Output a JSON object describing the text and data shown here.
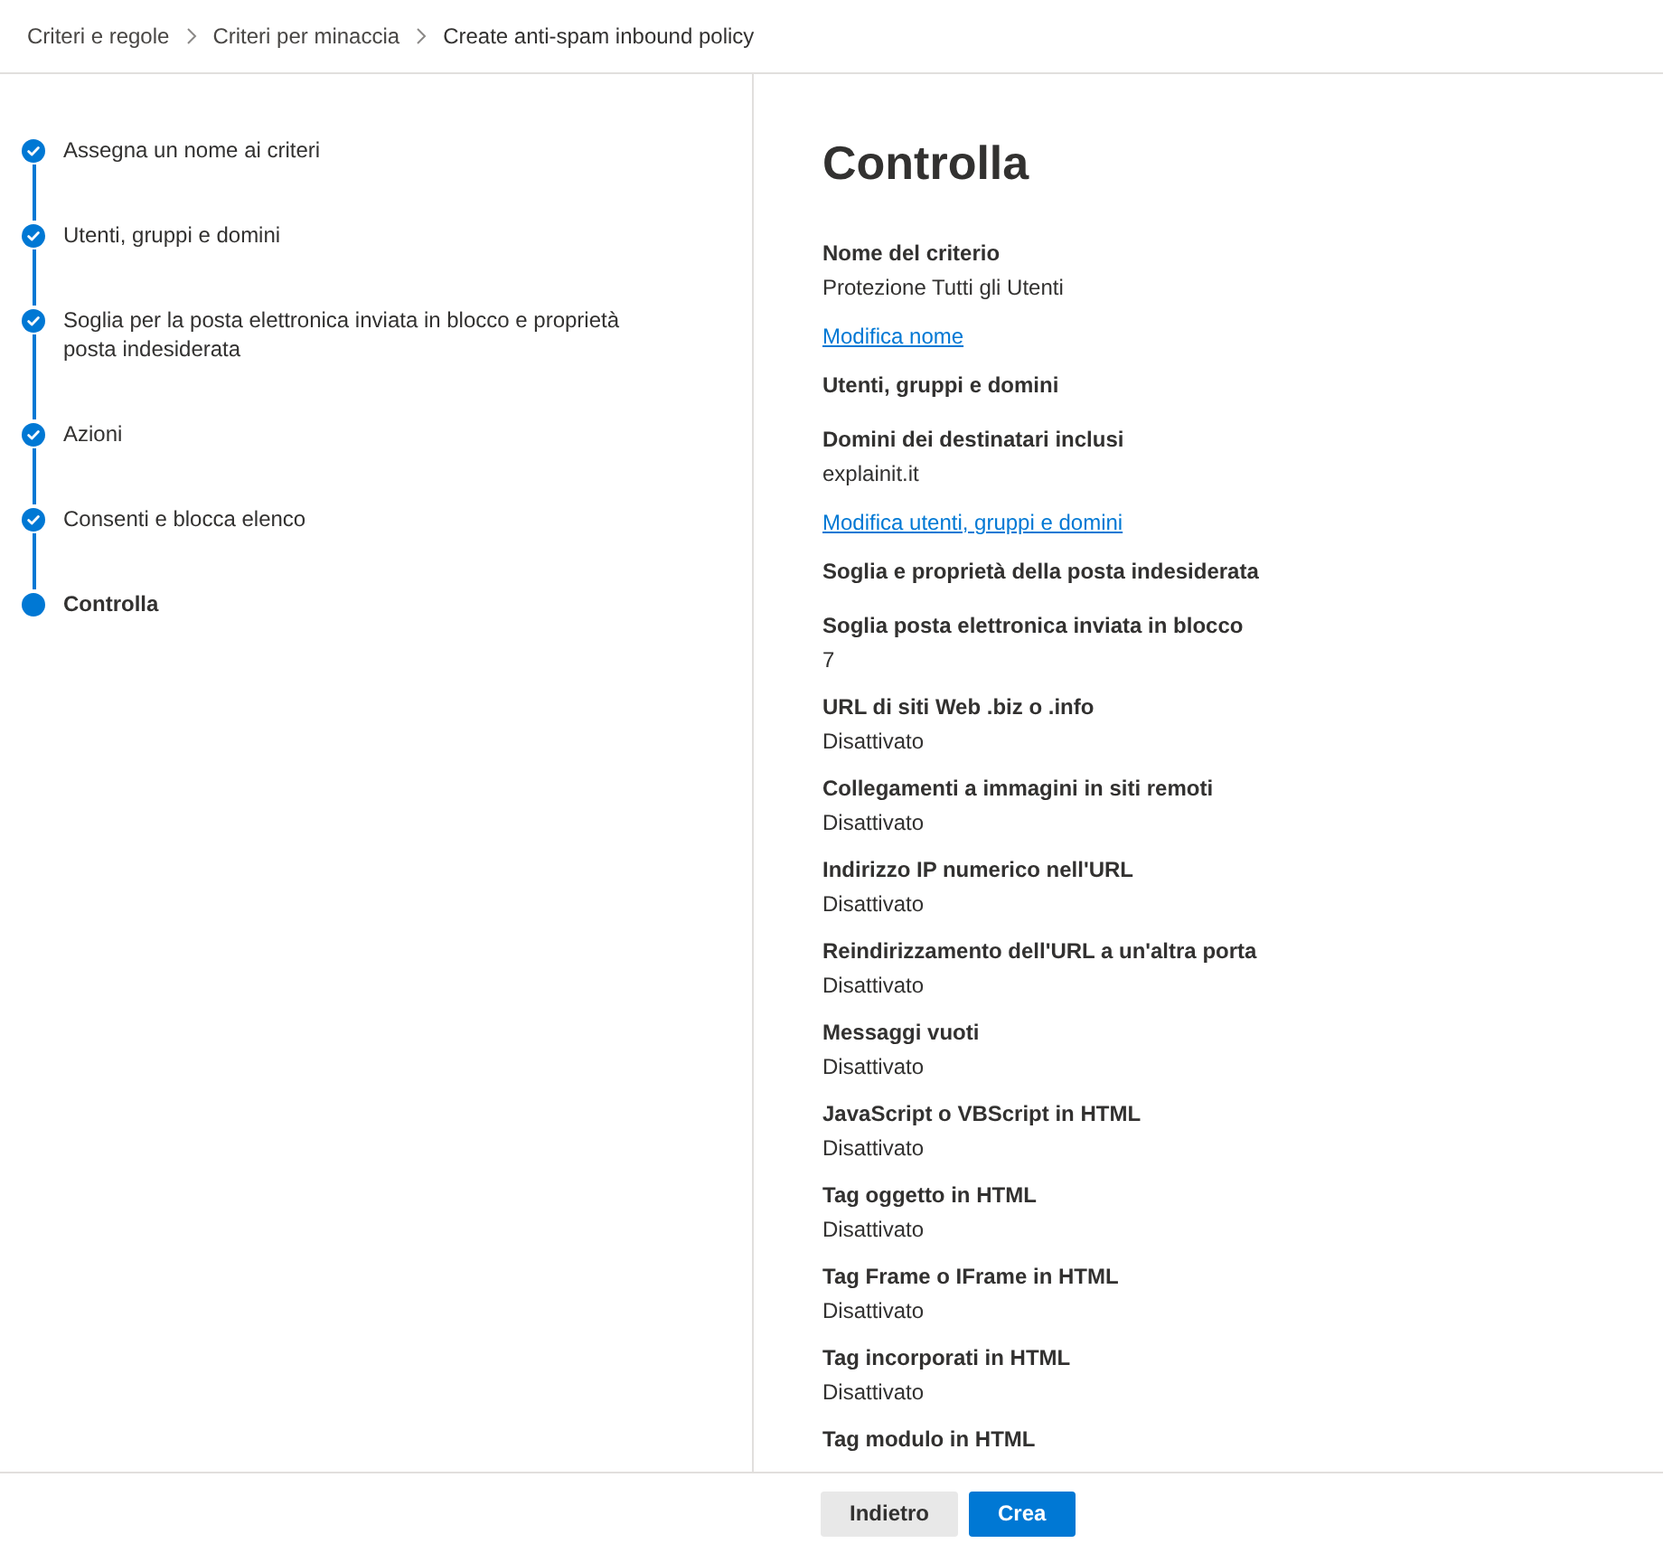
{
  "breadcrumb": [
    {
      "label": "Criteri e regole"
    },
    {
      "label": "Criteri per minaccia"
    },
    {
      "label": "Create anti-spam inbound policy"
    }
  ],
  "steps": [
    {
      "label": "Assegna un nome ai criteri",
      "completed": true,
      "selected": false
    },
    {
      "label": "Utenti, gruppi e domini",
      "completed": true,
      "selected": false
    },
    {
      "label": "Soglia per la posta elettronica inviata in blocco e proprietà posta indesiderata",
      "completed": true,
      "selected": false
    },
    {
      "label": "Azioni",
      "completed": true,
      "selected": false
    },
    {
      "label": "Consenti e blocca elenco",
      "completed": true,
      "selected": false
    },
    {
      "label": "Controlla",
      "completed": false,
      "selected": true
    }
  ],
  "review": {
    "title": "Controlla",
    "items": [
      {
        "kind": "field",
        "label": "Nome del criterio",
        "value": "Protezione Tutti gli Utenti"
      },
      {
        "kind": "link",
        "label": "Modifica nome"
      },
      {
        "kind": "heading",
        "label": "Utenti, gruppi e domini"
      },
      {
        "kind": "field",
        "label": "Domini dei destinatari inclusi",
        "value": "explainit.it"
      },
      {
        "kind": "link",
        "label": "Modifica utenti, gruppi e domini"
      },
      {
        "kind": "heading",
        "label": "Soglia e proprietà della posta indesiderata"
      },
      {
        "kind": "field",
        "label": "Soglia posta elettronica inviata in blocco",
        "value": "7"
      },
      {
        "kind": "field",
        "label": "URL di siti Web .biz o .info",
        "value": "Disattivato"
      },
      {
        "kind": "field",
        "label": "Collegamenti a immagini in siti remoti",
        "value": "Disattivato"
      },
      {
        "kind": "field",
        "label": "Indirizzo IP numerico nell'URL",
        "value": "Disattivato"
      },
      {
        "kind": "field",
        "label": "Reindirizzamento dell'URL a un'altra porta",
        "value": "Disattivato"
      },
      {
        "kind": "field",
        "label": "Messaggi vuoti",
        "value": "Disattivato"
      },
      {
        "kind": "field",
        "label": "JavaScript o VBScript in HTML",
        "value": "Disattivato"
      },
      {
        "kind": "field",
        "label": "Tag oggetto in HTML",
        "value": "Disattivato"
      },
      {
        "kind": "field",
        "label": "Tag Frame o IFrame in HTML",
        "value": "Disattivato"
      },
      {
        "kind": "field",
        "label": "Tag incorporati in HTML",
        "value": "Disattivato"
      },
      {
        "kind": "field",
        "label": "Tag modulo in HTML"
      }
    ]
  },
  "footer": {
    "buttons": [
      {
        "label": "Indietro",
        "primary": false
      },
      {
        "label": "Crea",
        "primary": true
      }
    ]
  }
}
